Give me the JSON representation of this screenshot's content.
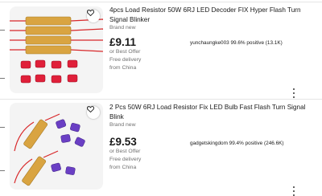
{
  "listings": [
    {
      "title": "4pcs Load Resistor 50W 6RJ LED Decoder FIX Hyper Flash Turn Signal Blinker",
      "condition": "Brand new",
      "price": "£9.11",
      "seller": "yunchaungke003 99.6% positive (13.1K)",
      "offer": "or Best Offer",
      "delivery": "Free delivery",
      "origin": "from China",
      "watch_icon": "heart-icon",
      "more_icon": "more-vertical-icon"
    },
    {
      "title": "2 Pcs 50W 6RJ Load Resistor Fix LED Bulb Fast Flash Turn Signal Blink",
      "condition": "Brand new",
      "price": "£9.53",
      "seller": "gadgetskingdom 99.4% positive (246.6K)",
      "offer": "or Best Offer",
      "delivery": "Free delivery",
      "origin": "from China",
      "watch_icon": "heart-icon",
      "more_icon": "more-vertical-icon"
    }
  ],
  "colors": {
    "resistor_gold": "#d9a441",
    "wire_red": "#d8282a",
    "connector_red": "#e0203a",
    "connector_purple": "#6a3fc4",
    "text_primary": "#191919",
    "text_secondary": "#707070"
  }
}
